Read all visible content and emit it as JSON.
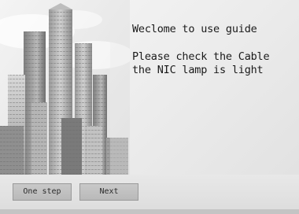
{
  "guide": {
    "title": "Weclome to use guide",
    "instruction_line1": "Please check the Cable",
    "instruction_line2": "the NIC lamp is light"
  },
  "buttons": {
    "one_step": "One step",
    "next": "Next"
  },
  "hero_image": {
    "subject": "city skyscrapers illustration",
    "tone": "grayscale"
  }
}
